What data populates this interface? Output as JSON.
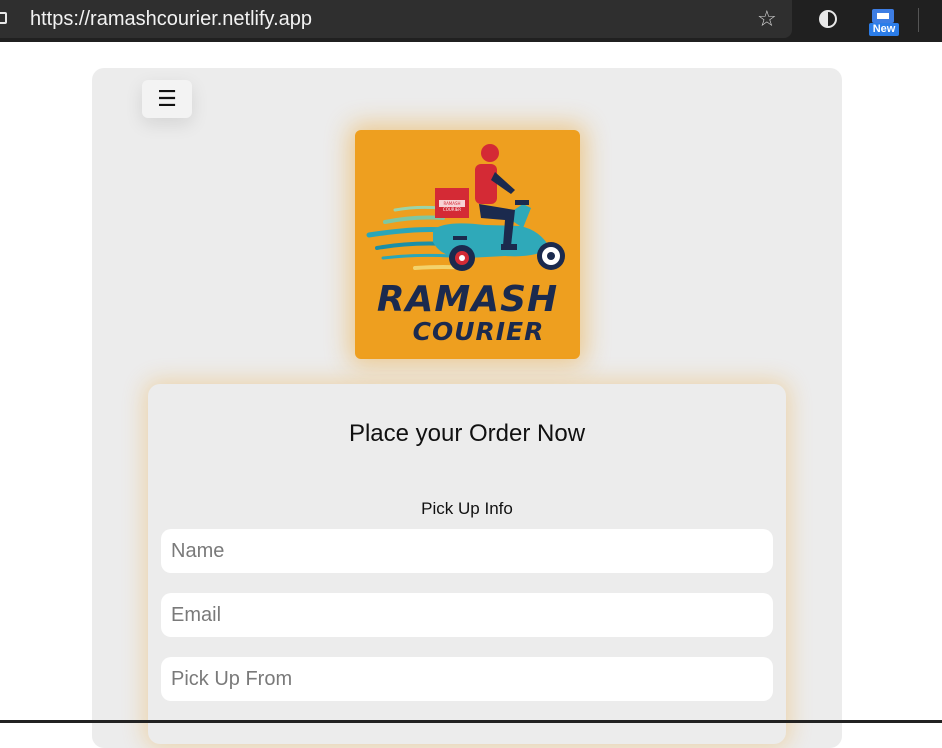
{
  "browser": {
    "url": "https://ramashcourier.netlify.app",
    "extension_badge": "New",
    "icons": [
      "lock-icon",
      "star-icon",
      "contrast-icon",
      "extension-icon"
    ]
  },
  "header": {
    "menu_icon": "☰"
  },
  "logo": {
    "line1": "RAMASH",
    "line2": "COURIER",
    "box_text_1": "RAMASH",
    "box_text_2": "COURIER",
    "colors": {
      "background": "#ee9f1f",
      "text": "#1b2a4e"
    }
  },
  "form": {
    "title": "Place your Order Now",
    "section_label": "Pick Up Info",
    "fields": [
      {
        "placeholder": "Name"
      },
      {
        "placeholder": "Email"
      },
      {
        "placeholder": "Pick Up From"
      }
    ]
  }
}
